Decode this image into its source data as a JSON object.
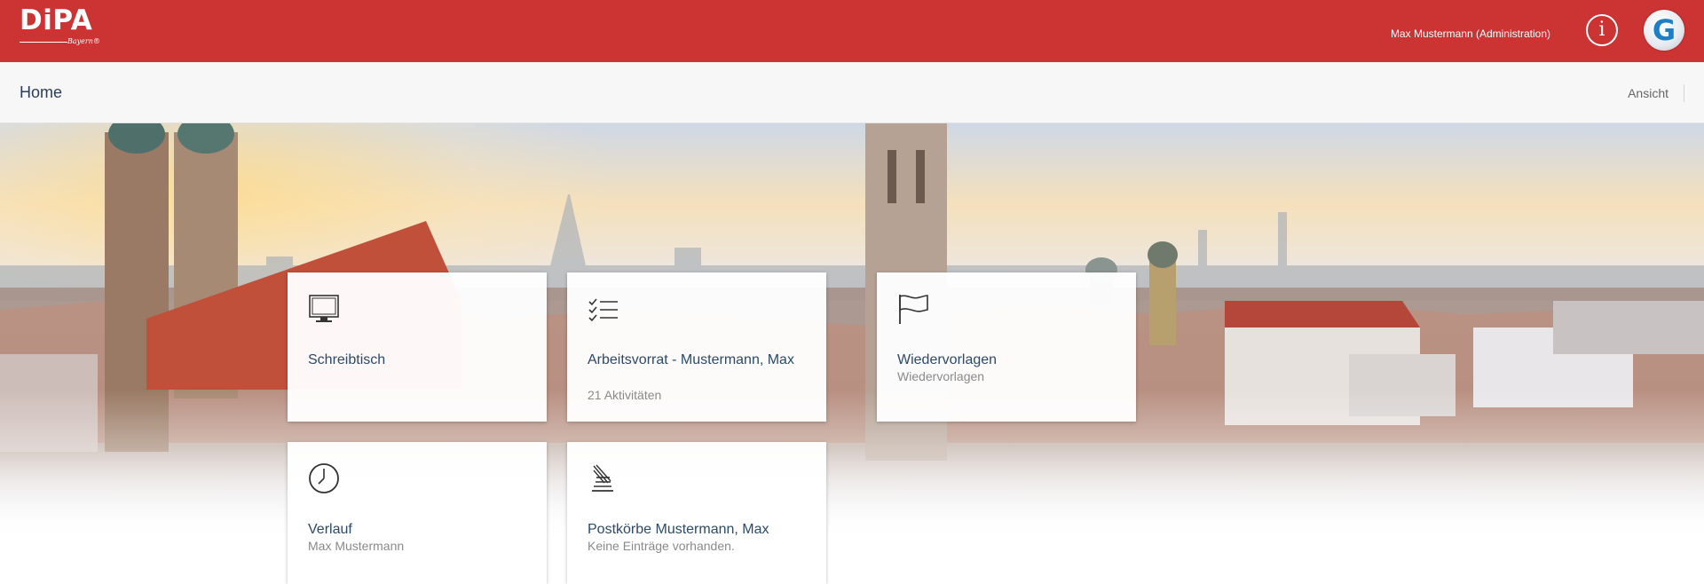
{
  "header": {
    "logo_text": "DiPA",
    "logo_sub": "Bayern®",
    "user": "Max Mustermann (Administration)",
    "info_label": "i",
    "app_logo_letter": "G"
  },
  "subheader": {
    "title": "Home",
    "view_label": "Ansicht"
  },
  "tiles": [
    {
      "title": "Schreibtisch",
      "subtitle": "",
      "icon": "monitor-icon"
    },
    {
      "title": "Arbeitsvorrat - Mustermann, Max",
      "subtitle": "21 Aktivitäten",
      "icon": "checklist-icon"
    },
    {
      "title": "Wiedervorlagen",
      "subtitle": "Wiedervorlagen",
      "icon": "flag-icon"
    },
    {
      "title": "Verlauf",
      "subtitle": "Max Mustermann",
      "icon": "clock-icon"
    },
    {
      "title": "Postkörbe Mustermann, Max",
      "subtitle": "Keine Einträge vorhanden.",
      "icon": "inbox-stack-icon"
    }
  ],
  "colors": {
    "header": "#cc3333",
    "title_text": "#2b4a6b",
    "subtitle_text": "#8a8a8a"
  }
}
